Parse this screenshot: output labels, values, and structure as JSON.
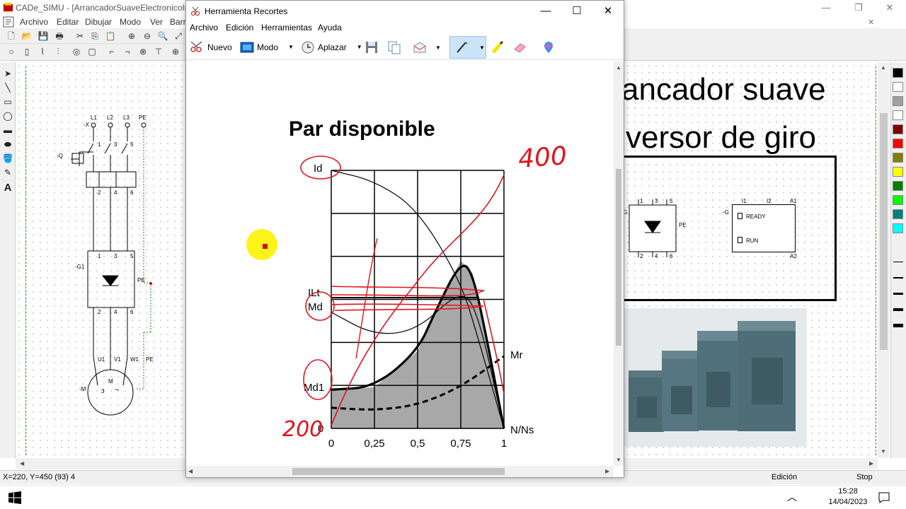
{
  "cade": {
    "title": "CADe_SIMU - [ArrancadorSuaveElectronicoInvesor.cad]",
    "menus": [
      "Archivo",
      "Editar",
      "Dibujar",
      "Modo",
      "Ver",
      "Barr"
    ],
    "window_controls": {
      "minimize": "—",
      "restore": "❐",
      "close": "✕"
    },
    "schematic": {
      "supply_labels": [
        "L1",
        "L2",
        "L3",
        "PE"
      ],
      "switch_label": "-Q",
      "switch_prefix": "-X",
      "terminal_top": [
        "1",
        "3",
        "5"
      ],
      "terminal_bottom": [
        "2",
        "4",
        "6"
      ],
      "starter_label": "-G1",
      "pe_label": "PE",
      "motor_terminals": [
        "U1",
        "V1",
        "W1",
        "PE"
      ],
      "motor_label": "-M",
      "motor_symbol_m": "M",
      "motor_symbol_3": "3",
      "motor_symbol_wave": "~",
      "right_block_pe": "PE",
      "right_block_side": "G",
      "control_terminals": [
        "I1",
        "I2",
        "A1"
      ],
      "control_label": "-G",
      "control_ready": "READY",
      "control_run": "RUN",
      "control_a2": "A2"
    },
    "heading_line1": "ancador suave",
    "heading_line2": "versor de giro",
    "status": {
      "coords": "X=220, Y=450 (93) 4",
      "mode": "Edición",
      "run": "Stop"
    },
    "palette_colors": [
      "#000000",
      "#ffffff",
      "#a0a0a0",
      "#ffffff",
      "#800000",
      "#ff0000",
      "#808000",
      "#ffff00",
      "#008000",
      "#00ff00",
      "#008080",
      "#00ffff"
    ]
  },
  "snip": {
    "title": "Herramienta Recortes",
    "menus": [
      "Archivo",
      "Edición",
      "Herramientas",
      "Ayuda"
    ],
    "toolbar": {
      "new_label": "Nuevo",
      "mode_label": "Modo",
      "delay_label": "Aplazar"
    },
    "window_controls": {
      "minimize": "—",
      "maximize": "☐",
      "close": "✕"
    }
  },
  "chart_data": {
    "type": "line",
    "title": "Par disponible",
    "xlabel": "N/Ns",
    "ylabel": "",
    "x_ticks": [
      "0",
      "0,25",
      "0,5",
      "0,75",
      "1"
    ],
    "y_labels": [
      "Id",
      "ILt",
      "Md",
      "Md1",
      "0"
    ],
    "curve_labels": [
      "Mr"
    ],
    "handwritten": [
      "400",
      "200"
    ],
    "grid": true,
    "series": [
      {
        "values": [
          [
            0,
            1.0
          ],
          [
            0.25,
            0.96
          ],
          [
            0.5,
            0.85
          ],
          [
            0.75,
            0.57
          ],
          [
            0.85,
            0.35
          ],
          [
            1,
            0.0
          ]
        ]
      },
      {
        "values": [
          [
            0,
            0.45
          ],
          [
            0.25,
            0.36
          ],
          [
            0.5,
            0.38
          ],
          [
            0.75,
            0.54
          ],
          [
            0.85,
            0.45
          ],
          [
            1,
            0.0
          ]
        ]
      },
      {
        "values": [
          [
            0,
            0.15
          ],
          [
            0.25,
            0.16
          ],
          [
            0.5,
            0.3
          ],
          [
            0.6,
            0.45
          ],
          [
            0.75,
            0.65
          ],
          [
            0.82,
            0.6
          ],
          [
            0.9,
            0.35
          ],
          [
            1,
            0.0
          ]
        ]
      },
      {
        "name": "Mr",
        "values": [
          [
            0,
            0.08
          ],
          [
            0.25,
            0.07
          ],
          [
            0.5,
            0.09
          ],
          [
            0.75,
            0.16
          ],
          [
            1,
            0.28
          ]
        ]
      }
    ]
  },
  "taskbar": {
    "time": "15:28",
    "date": "14/04/2023",
    "chevron": "︿"
  }
}
